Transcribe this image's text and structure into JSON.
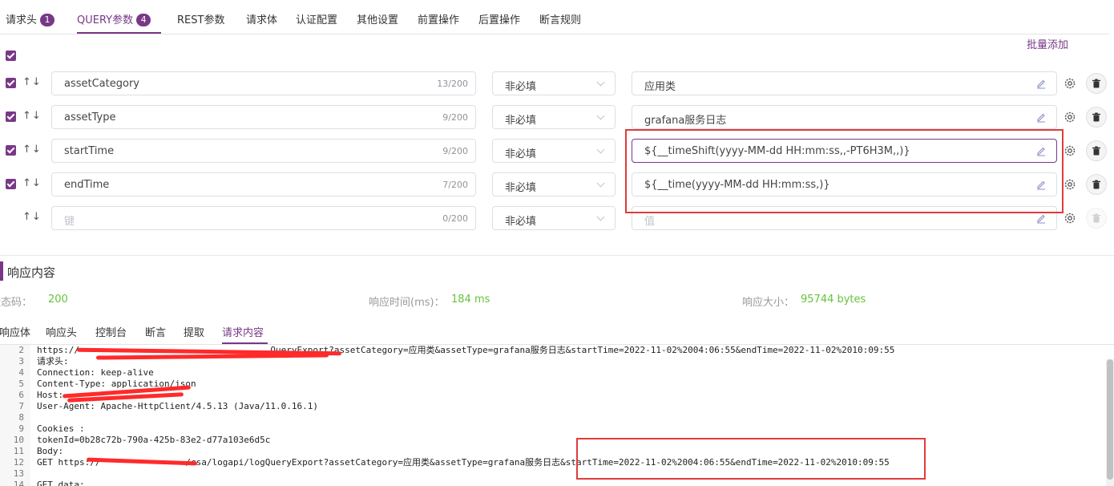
{
  "tabs": [
    {
      "label": "请求头",
      "badge": "1"
    },
    {
      "label": "QUERY参数",
      "badge": "4"
    },
    {
      "label": "REST参数",
      "badge": ""
    },
    {
      "label": "请求体",
      "badge": ""
    },
    {
      "label": "认证配置",
      "badge": ""
    },
    {
      "label": "其他设置",
      "badge": ""
    },
    {
      "label": "前置操作",
      "badge": ""
    },
    {
      "label": "后置操作",
      "badge": ""
    },
    {
      "label": "断言规则",
      "badge": ""
    }
  ],
  "batch_add": "批量添加",
  "params": [
    {
      "name": "assetCategory",
      "count": "13/200",
      "required": "非必填",
      "value": "应用类",
      "checked": true
    },
    {
      "name": "assetType",
      "count": "9/200",
      "required": "非必填",
      "value": "grafana服务日志",
      "checked": true
    },
    {
      "name": "startTime",
      "count": "9/200",
      "required": "非必填",
      "value": "${__timeShift(yyyy-MM-dd HH:mm:ss,,-PT6H3M,,)}",
      "checked": true
    },
    {
      "name": "endTime",
      "count": "7/200",
      "required": "非必填",
      "value": "${__time(yyyy-MM-dd HH:mm:ss,)}",
      "checked": true
    }
  ],
  "new_param": {
    "name_placeholder": "键",
    "count": "0/200",
    "required": "非必填",
    "value_placeholder": "值"
  },
  "response": {
    "title": "响应内容",
    "status_label": "状态码：",
    "status_value": "200",
    "time_label": "响应时间(ms)：",
    "time_value": "184 ms",
    "size_label": "响应大小：",
    "size_value": "95744 bytes",
    "tabs": [
      "响应体",
      "响应头",
      "控制台",
      "断言",
      "提取",
      "请求内容"
    ]
  },
  "code_lines": [
    {
      "n": "2",
      "t": "https://                                    QueryExport?assetCategory=应用类&assetType=grafana服务日志&startTime=2022-11-02%2004:06:55&endTime=2022-11-02%2010:09:55"
    },
    {
      "n": "3",
      "t": "请求头:"
    },
    {
      "n": "4",
      "t": "Connection: keep-alive"
    },
    {
      "n": "5",
      "t": "Content-Type: application/json"
    },
    {
      "n": "6",
      "t": "Host:"
    },
    {
      "n": "7",
      "t": "User-Agent: Apache-HttpClient/4.5.13 (Java/11.0.16.1)"
    },
    {
      "n": "8",
      "t": ""
    },
    {
      "n": "9",
      "t": "Cookies :"
    },
    {
      "n": "10",
      "t": "tokenId=0b28c72b-790a-425b-83e2-d77a103e6d5c"
    },
    {
      "n": "11",
      "t": "Body:"
    },
    {
      "n": "12",
      "t": "GET https://                /csa/logapi/logQueryExport?assetCategory=应用类&assetType=grafana服务日志&startTime=2022-11-02%2004:06:55&endTime=2022-11-02%2010:09:55"
    },
    {
      "n": "13",
      "t": ""
    },
    {
      "n": "14",
      "t": "GET data:"
    }
  ],
  "colors": {
    "accent": "#783887",
    "success": "#67c23a",
    "highlight": "#e03b3b"
  }
}
